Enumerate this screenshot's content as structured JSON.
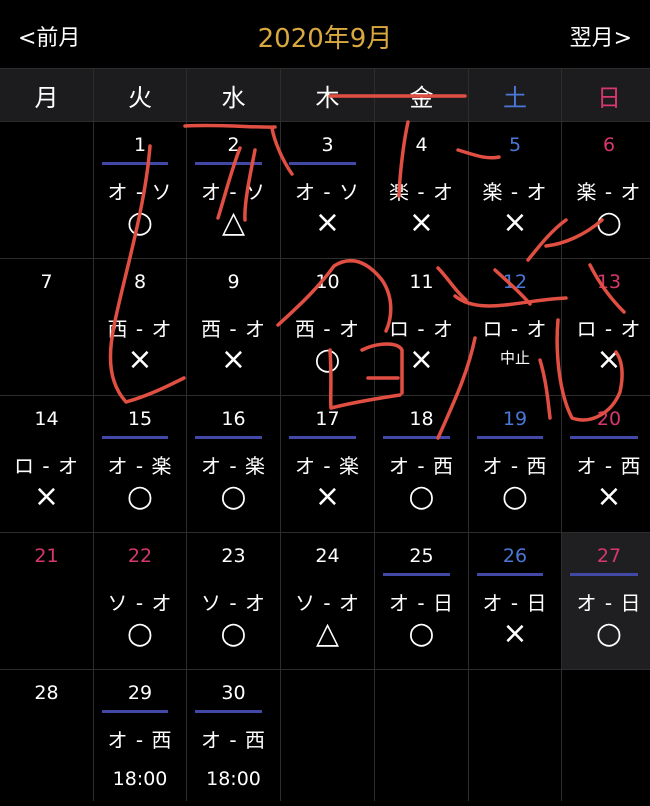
{
  "header": {
    "prev_label": "<前月",
    "next_label": "翌月>",
    "title": "2020年9月",
    "title_color": "#d9a940"
  },
  "weekdays": [
    "月",
    "火",
    "水",
    "木",
    "金",
    "土",
    "日"
  ],
  "colors": {
    "saturday": "#4a78d8",
    "sunday_holiday": "#d5376e",
    "game_bar": "#4148a6"
  },
  "cells": [
    {
      "day": ""
    },
    {
      "day": "1",
      "kind": "normal",
      "bar": true,
      "match": "オ - ソ",
      "result": "○"
    },
    {
      "day": "2",
      "kind": "normal",
      "bar": true,
      "match": "オ - ソ",
      "result": "△"
    },
    {
      "day": "3",
      "kind": "normal",
      "bar": true,
      "match": "オ - ソ",
      "result": "×"
    },
    {
      "day": "4",
      "kind": "normal",
      "bar": false,
      "match": "楽 - オ",
      "result": "×"
    },
    {
      "day": "5",
      "kind": "sat",
      "bar": false,
      "match": "楽 - オ",
      "result": "×"
    },
    {
      "day": "6",
      "kind": "sun",
      "bar": false,
      "match": "楽 - オ",
      "result": "○"
    },
    {
      "day": "7",
      "kind": "normal",
      "bar": false
    },
    {
      "day": "8",
      "kind": "normal",
      "bar": false,
      "match": "西 - オ",
      "result": "×"
    },
    {
      "day": "9",
      "kind": "normal",
      "bar": false,
      "match": "西 - オ",
      "result": "×"
    },
    {
      "day": "10",
      "kind": "normal",
      "bar": false,
      "match": "西 - オ",
      "result": "○"
    },
    {
      "day": "11",
      "kind": "normal",
      "bar": false,
      "match": "ロ - オ",
      "result": "×"
    },
    {
      "day": "12",
      "kind": "sat",
      "bar": false,
      "match": "ロ - オ",
      "note": "中止"
    },
    {
      "day": "13",
      "kind": "sun",
      "bar": false,
      "match": "ロ - オ",
      "result": "×"
    },
    {
      "day": "14",
      "kind": "normal",
      "bar": false,
      "match": "ロ - オ",
      "result": "×"
    },
    {
      "day": "15",
      "kind": "normal",
      "bar": true,
      "match": "オ - 楽",
      "result": "○"
    },
    {
      "day": "16",
      "kind": "normal",
      "bar": true,
      "match": "オ - 楽",
      "result": "○"
    },
    {
      "day": "17",
      "kind": "normal",
      "bar": true,
      "match": "オ - 楽",
      "result": "×"
    },
    {
      "day": "18",
      "kind": "normal",
      "bar": true,
      "match": "オ - 西",
      "result": "○"
    },
    {
      "day": "19",
      "kind": "sat",
      "bar": true,
      "match": "オ - 西",
      "result": "○"
    },
    {
      "day": "20",
      "kind": "sun",
      "bar": true,
      "match": "オ - 西",
      "result": "×"
    },
    {
      "day": "21",
      "kind": "sun",
      "bar": false
    },
    {
      "day": "22",
      "kind": "sun",
      "bar": false,
      "match": "ソ - オ",
      "result": "○"
    },
    {
      "day": "23",
      "kind": "normal",
      "bar": false,
      "match": "ソ - オ",
      "result": "○"
    },
    {
      "day": "24",
      "kind": "normal",
      "bar": false,
      "match": "ソ - オ",
      "result": "△"
    },
    {
      "day": "25",
      "kind": "normal",
      "bar": true,
      "match": "オ - 日",
      "result": "○"
    },
    {
      "day": "26",
      "kind": "sat",
      "bar": true,
      "match": "オ - 日",
      "result": "×"
    },
    {
      "day": "27",
      "kind": "sun",
      "bar": true,
      "match": "オ - 日",
      "result": "○",
      "today": true
    },
    {
      "day": "28",
      "kind": "normal",
      "bar": false
    },
    {
      "day": "29",
      "kind": "normal",
      "bar": true,
      "match": "オ - 西",
      "time": "18:00"
    },
    {
      "day": "30",
      "kind": "normal",
      "bar": true,
      "match": "オ - 西",
      "time": "18:00"
    },
    {
      "day": ""
    },
    {
      "day": ""
    },
    {
      "day": ""
    },
    {
      "day": ""
    }
  ]
}
